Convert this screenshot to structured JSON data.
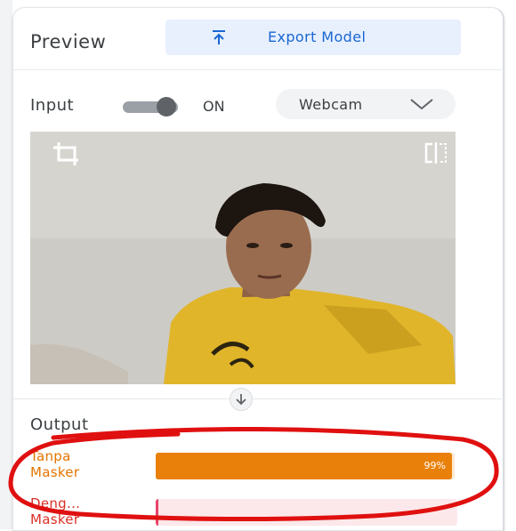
{
  "header": {
    "title": "Preview",
    "export_label": "Export Model",
    "export_icon": "upload-icon"
  },
  "input": {
    "label": "Input",
    "toggle_state": "ON",
    "source_selected": "Webcam"
  },
  "output": {
    "label": "Output",
    "classes": [
      {
        "name": "Tanpa Masker",
        "line1": "Tanpa",
        "line2": "Masker",
        "percent_text": "99%",
        "confidence": 0.99,
        "color": "#e8800a"
      },
      {
        "name": "Deng... Masker",
        "line1": "Deng...",
        "line2": "Masker",
        "percent_text": "",
        "confidence": 0.01,
        "color": "#e8426a"
      }
    ]
  },
  "annotation": {
    "color": "#e01010"
  }
}
